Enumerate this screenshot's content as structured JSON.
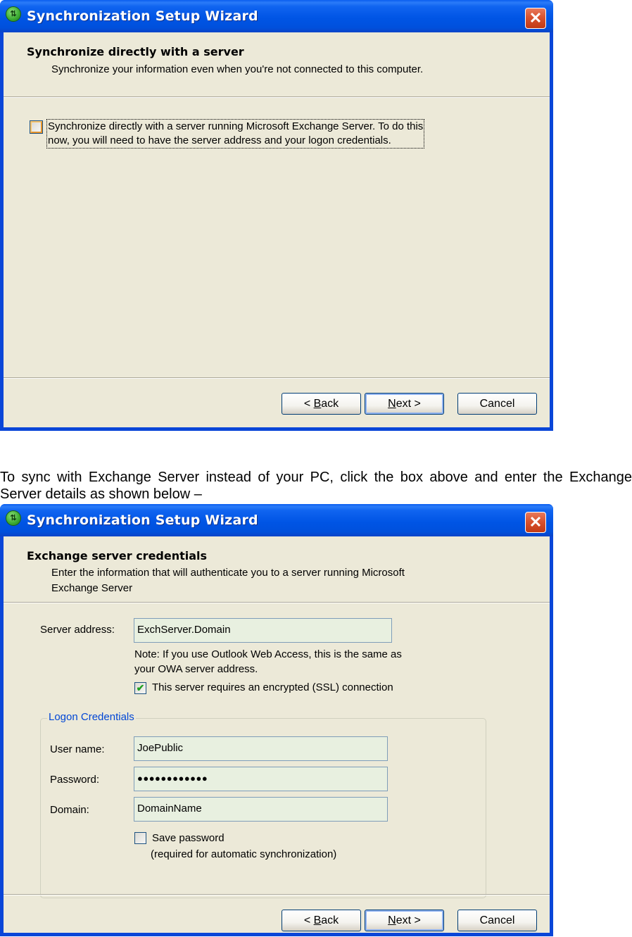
{
  "dialog1": {
    "window_title": "Synchronization Setup Wizard",
    "title_icon": "sync-icon",
    "close_label": "✕",
    "header_title": "Synchronize directly with a server",
    "header_subtitle": "Synchronize your information even when you're not connected to this computer.",
    "checkbox": {
      "checked": false,
      "label_line1": "Synchronize directly with a server running Microsoft Exchange Server.  To do this",
      "label_line2": "now, you will need to have the server address and your logon credentials."
    },
    "buttons": {
      "back_prefix": "< ",
      "back_mnemonic": "B",
      "back_rest": "ack",
      "next_mnemonic": "N",
      "next_rest": "ext >",
      "cancel": "Cancel"
    }
  },
  "instruction_text": "To sync with Exchange Server instead of your PC, click the box above and enter the Exchange Server details as shown below –",
  "dialog2": {
    "window_title": "Synchronization Setup Wizard",
    "title_icon": "sync-icon",
    "close_label": "✕",
    "header_title": "Exchange server credentials",
    "header_subtitle_line1": "Enter the information that will authenticate you to a server running Microsoft",
    "header_subtitle_line2": "Exchange Server",
    "server_address_label": "Server address:",
    "server_address_value": "ExchServer.Domain",
    "note_line1": "Note: If you use Outlook Web Access, this is the same as",
    "note_line2": "your OWA server address.",
    "ssl_checkbox": {
      "checked": true,
      "check_glyph": "✔",
      "label": "This server requires an encrypted (SSL) connection"
    },
    "logon_group_title": "Logon Credentials",
    "username_label": "User name:",
    "username_value": "JoePublic",
    "password_label": "Password:",
    "password_value": "●●●●●●●●●●●●",
    "domain_label": "Domain:",
    "domain_value": "DomainName",
    "save_password_checkbox": {
      "checked": false,
      "label": "Save password",
      "sublabel": "(required for automatic synchronization)"
    },
    "buttons": {
      "back_prefix": "< ",
      "back_mnemonic": "B",
      "back_rest": "ack",
      "next_mnemonic": "N",
      "next_rest": "ext >",
      "cancel": "Cancel"
    }
  },
  "colors": {
    "titlebar_blue": "#0055e5",
    "dialog_bg": "#ece9d8",
    "close_red": "#d9532f",
    "textbox_bg": "#e8f0e0",
    "group_title_blue": "#0046d5",
    "check_green": "#21a121"
  }
}
